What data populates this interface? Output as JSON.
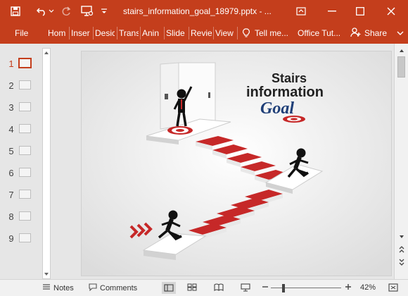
{
  "window": {
    "title": "stairs_information_goal_18979.pptx - ...",
    "accent_color": "#c43e1c"
  },
  "quick_access": {
    "icons": [
      "save-icon",
      "undo-icon",
      "redo-icon",
      "present-icon",
      "customize-icon"
    ]
  },
  "ribbon": {
    "file_label": "File",
    "tabs": [
      "Hom",
      "Inser",
      "Desic",
      "Trans",
      "Anin",
      "Slide",
      "Revie",
      "View"
    ],
    "tell_me": "Tell me...",
    "office_tutorials": "Office Tut...",
    "share_label": "Share"
  },
  "slide_panel": {
    "slides": [
      {
        "number": "1",
        "active": true
      },
      {
        "number": "2",
        "active": false
      },
      {
        "number": "3",
        "active": false
      },
      {
        "number": "4",
        "active": false
      },
      {
        "number": "5",
        "active": false
      },
      {
        "number": "6",
        "active": false
      },
      {
        "number": "7",
        "active": false
      },
      {
        "number": "8",
        "active": false
      },
      {
        "number": "9",
        "active": false
      }
    ]
  },
  "slide": {
    "logo_line1": "Stairs",
    "logo_line2": "information",
    "logo_line3": "Goal"
  },
  "statusbar": {
    "notes_label": "Notes",
    "comments_label": "Comments",
    "zoom_percent": "42%",
    "zoom_fraction": 0.42
  }
}
